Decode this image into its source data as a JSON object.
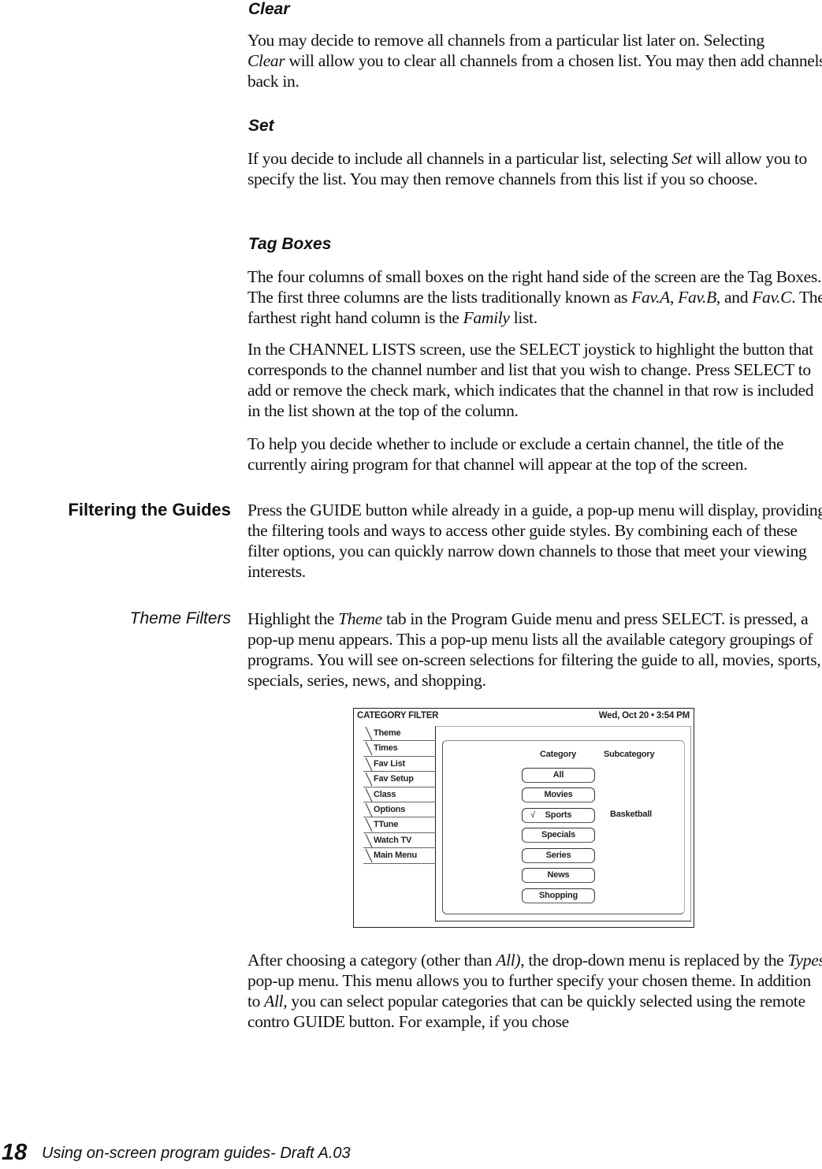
{
  "sections": {
    "clear": {
      "heading": "Clear",
      "p1": [
        "You may decide to remove all channels from a particular list later on. Selecting",
        "Clear",
        " will allow you to clear all channels from a chosen list. You may then add channels back in."
      ]
    },
    "set": {
      "heading": "Set",
      "p1": [
        "If you decide to include all channels in a particular list, selecting ",
        "Set",
        " will allow you to specify the list. You may then remove channels from this list if you so choose."
      ]
    },
    "tag_boxes": {
      "heading": "Tag Boxes",
      "p1": [
        "The four columns of small boxes on the right hand side of the screen are the Tag Boxes. The first three columns are the lists traditionally known as ",
        "Fav.A",
        ", ",
        "Fav.B",
        ", and ",
        "Fav.C",
        ". The farthest right hand column is the ",
        "Family",
        " list."
      ],
      "p2": "In the CHANNEL LISTS screen, use the SELECT joystick to highlight the button that corresponds to the channel number and list that you wish to change. Press SELECT to add or remove the check mark, which indicates that the channel in that row is included in the list shown at the top of the column.",
      "p3": "To help you decide whether to include or exclude a certain channel, the title of the currently airing program for that channel will appear at the top of the screen."
    },
    "filtering": {
      "side_heading": "Filtering the Guides",
      "p1": "Press the GUIDE button while already in a guide, a pop-up menu will display, providing the filtering tools and ways to access other guide styles. By combining each of these filter options, you can quickly narrow down channels to those that meet your viewing interests."
    },
    "theme_filters": {
      "side_heading": "Theme Filters",
      "p1": [
        "Highlight the ",
        "Theme",
        " tab in the Program Guide menu and press SELECT. is pressed, a pop-up menu appears. This a pop-up menu lists all the available category groupings of programs. You will see on-screen selections for filtering the guide to all, movies, sports, specials, series, news, and shopping."
      ],
      "p2": [
        "After choosing a category (other than ",
        "All)",
        ", the drop-down menu is replaced by the ",
        "Types",
        " pop-up menu. This menu allows you to further specify your chosen theme. In addition to ",
        "All",
        ", you can select popular categories that can be quickly selected using the remote contro GUIDE button. For example, if you chose"
      ]
    }
  },
  "diagram": {
    "title": "CATEGORY FILTER",
    "datetime": "Wed, Oct 20  •  3:54 PM",
    "tabs": [
      "Theme",
      "Times",
      "Fav List",
      "Fav Setup",
      "Class",
      "Options",
      "TTune",
      "Watch TV",
      "Main Menu"
    ],
    "category_header": "Category",
    "subcategory_header": "Subcategory",
    "categories": [
      {
        "label": "All",
        "checked": false
      },
      {
        "label": "Movies",
        "checked": false
      },
      {
        "label": "Sports",
        "checked": true
      },
      {
        "label": "Specials",
        "checked": false
      },
      {
        "label": "Series",
        "checked": false
      },
      {
        "label": "News",
        "checked": false
      },
      {
        "label": "Shopping",
        "checked": false
      }
    ],
    "check_glyph": "√",
    "selected_subcategory": "Basketball"
  },
  "footer": {
    "page_number": "18",
    "running_title": "Using on-screen program guides- Draft A.03"
  }
}
